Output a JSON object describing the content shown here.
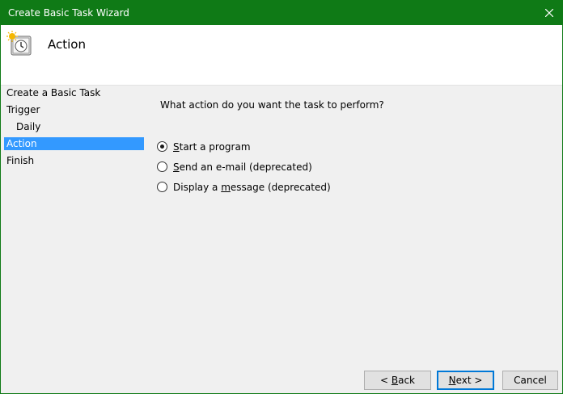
{
  "window": {
    "title": "Create Basic Task Wizard"
  },
  "header": {
    "title": "Action",
    "icon": "scheduled-task-clock-icon"
  },
  "steps": [
    {
      "label": "Create a Basic Task"
    },
    {
      "label": "Trigger"
    },
    {
      "label": "Daily"
    },
    {
      "label": "Action",
      "selected": true
    },
    {
      "label": "Finish"
    }
  ],
  "main": {
    "question": "What action do you want the task to perform?",
    "options": [
      {
        "pre": "",
        "mn": "S",
        "post": "tart a program",
        "checked": true
      },
      {
        "pre": "",
        "mn": "S",
        "post": "end an e-mail (deprecated)",
        "checked": false
      },
      {
        "pre": "Display a ",
        "mn": "m",
        "post": "essage (deprecated)",
        "checked": false
      }
    ]
  },
  "buttons": {
    "back_prefix": "< ",
    "back_mn": "B",
    "back_rest": "ack",
    "next_mn": "N",
    "next_rest": "ext >",
    "cancel": "Cancel"
  },
  "colors": {
    "titlebar": "#0f7a16",
    "selection": "#3399ff",
    "default_button_border": "#0078d7"
  }
}
